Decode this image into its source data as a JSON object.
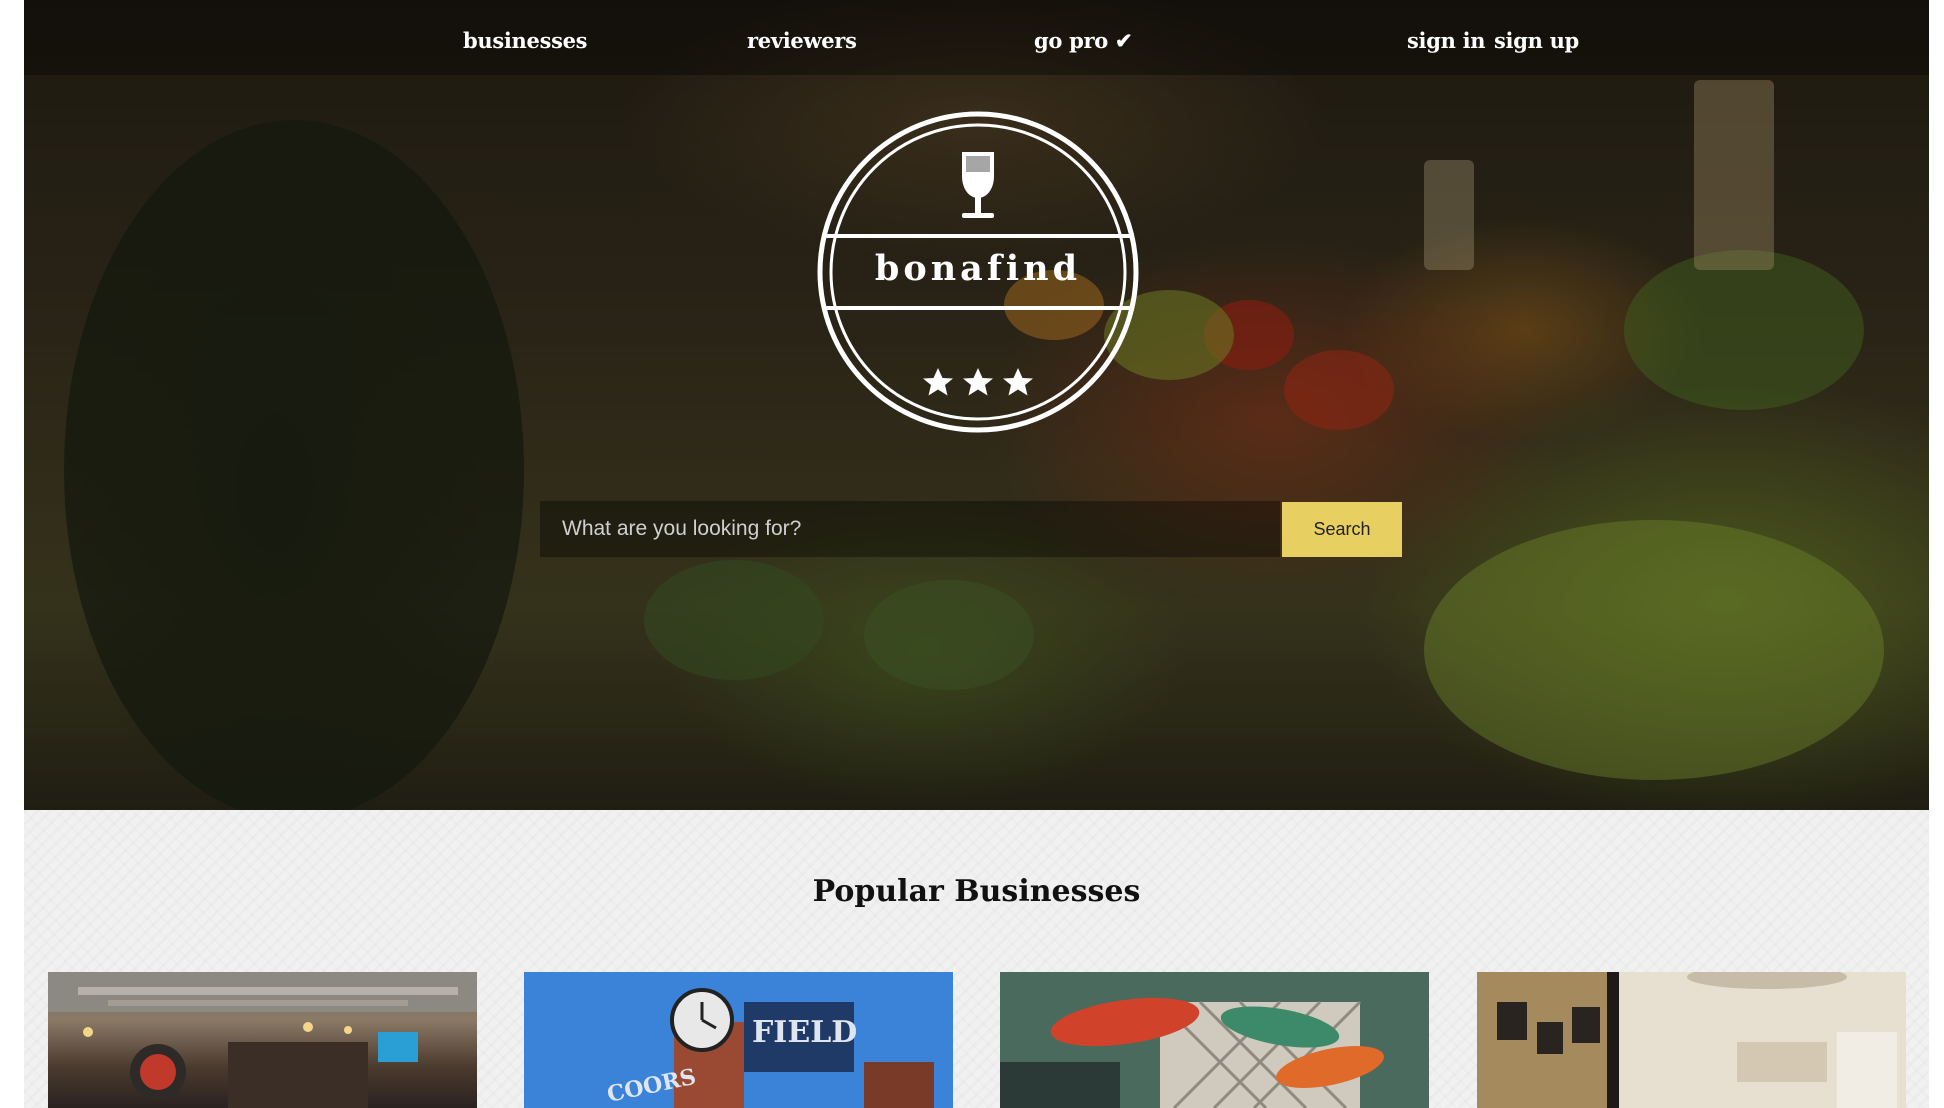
{
  "nav": {
    "businesses": "businesses",
    "reviewers": "reviewers",
    "go_pro": "go pro ✔",
    "sign_in": "sign in",
    "sign_up": "sign up"
  },
  "logo": {
    "brand": "bonafind",
    "icon": "wine-glass-icon",
    "stars": 3
  },
  "search": {
    "placeholder": "What are you looking for?",
    "button_label": "Search"
  },
  "popular": {
    "title": "Popular Businesses",
    "cards": [
      {
        "image": "restaurant-interior"
      },
      {
        "image": "coors-field-stadium",
        "sign_text": "FIELD",
        "sign_text_2": "COORS"
      },
      {
        "image": "bar-with-surfboard-signs"
      },
      {
        "image": "cafe-interior-with-frames"
      }
    ]
  },
  "colors": {
    "accent": "#e8cf62",
    "nav_text": "#ffffff",
    "section_bg": "#f1f1f1"
  }
}
